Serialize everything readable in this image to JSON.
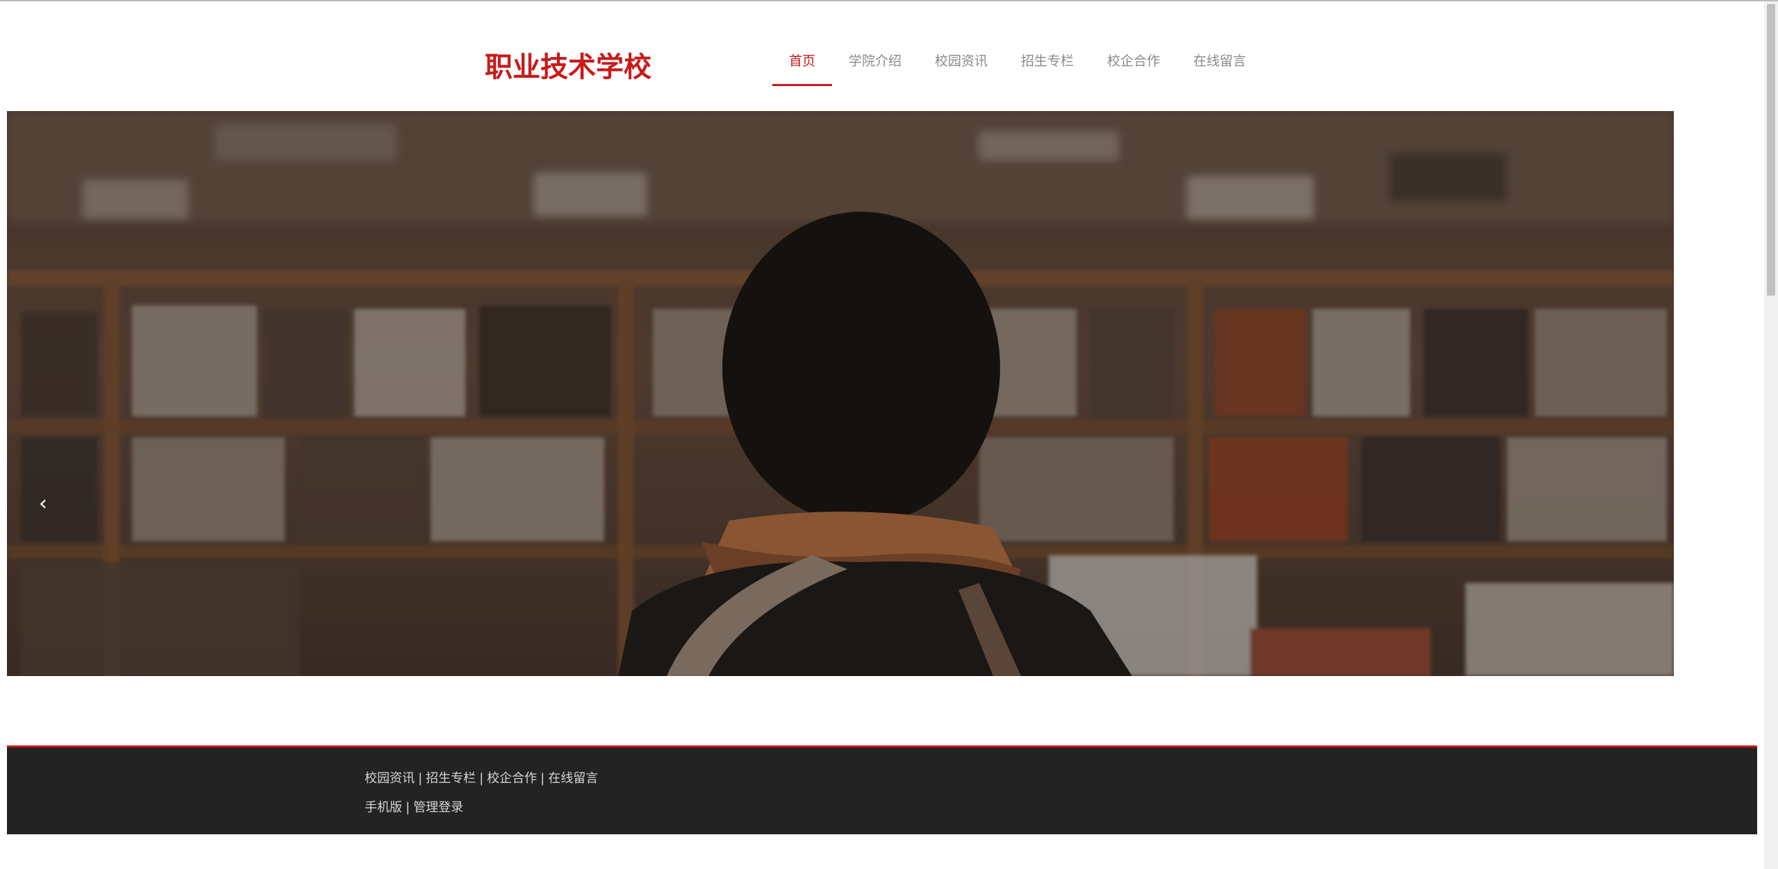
{
  "header": {
    "logo": "职业技术学校",
    "nav": [
      {
        "label": "首页",
        "active": true
      },
      {
        "label": "学院介绍",
        "active": false
      },
      {
        "label": "校园资讯",
        "active": false
      },
      {
        "label": "招生专栏",
        "active": false
      },
      {
        "label": "校企合作",
        "active": false
      },
      {
        "label": "在线留言",
        "active": false
      }
    ]
  },
  "banner": {
    "prev_icon": "‹",
    "next_icon": "›",
    "slide_count": 2,
    "active_slide": 1
  },
  "footer": {
    "row1": [
      "校园资讯",
      "招生专栏",
      "校企合作",
      "在线留言"
    ],
    "row2": [
      "手机版",
      "管理登录"
    ],
    "separator": "|"
  },
  "colors": {
    "accent": "#c91a1a",
    "footer_bg": "#232323"
  }
}
